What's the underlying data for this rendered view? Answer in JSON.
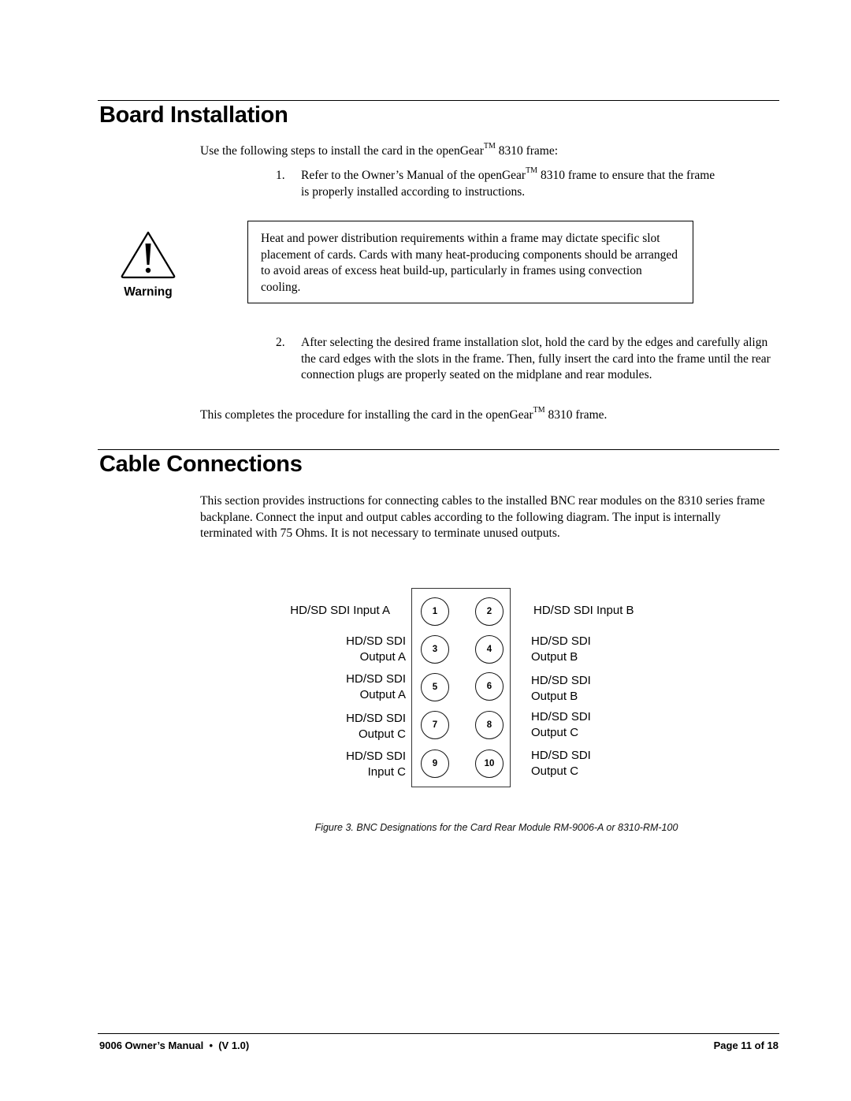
{
  "board_installation": {
    "heading": "Board Installation",
    "intro_prefix": "Use the following steps to install the card in the openGear",
    "tm": "TM",
    "intro_suffix": " 8310 frame:",
    "steps": [
      {
        "number": "1.",
        "line1_prefix": "Refer to the Owner’s Manual of the openGear",
        "line1_suffix": " 8310 frame to ensure that the frame",
        "line2": "is properly installed according to instructions."
      },
      {
        "number": "2.",
        "text": "After selecting the desired frame installation slot, hold the card by the edges and carefully align the card edges with the slots in the frame.  Then, fully insert the card into the frame until the rear connection plugs are properly seated on the midplane and rear modules."
      }
    ],
    "warning": {
      "icon": "warning-triangle-icon",
      "label": "Warning",
      "text": "Heat and power distribution requirements within a frame may dictate specific slot placement of cards.  Cards with many heat-producing components should be arranged to avoid areas of excess heat build-up, particularly in frames using convection cooling."
    },
    "conclusion_prefix": "This completes the procedure for installing the card in the openGear",
    "conclusion_suffix": " 8310 frame."
  },
  "cable_connections": {
    "heading": "Cable Connections",
    "body": "This section provides instructions for connecting cables to the installed BNC rear modules on the 8310 series frame backplane. Connect the input and output cables according to the following diagram. The input is internally terminated with 75 Ohms.  It is not necessary to terminate unused outputs.",
    "diagram": {
      "connectors": [
        {
          "number": "1",
          "label_lines": [
            "HD/SD SDI Input A"
          ]
        },
        {
          "number": "2",
          "label_lines": [
            "HD/SD SDI Input B"
          ]
        },
        {
          "number": "3",
          "label_lines": [
            "HD/SD SDI",
            "Output A"
          ]
        },
        {
          "number": "4",
          "label_lines": [
            "HD/SD SDI",
            "Output B"
          ]
        },
        {
          "number": "5",
          "label_lines": [
            "HD/SD SDI",
            "Output A"
          ]
        },
        {
          "number": "6",
          "label_lines": [
            "HD/SD SDI",
            "Output B"
          ]
        },
        {
          "number": "7",
          "label_lines": [
            "HD/SD SDI",
            "Output C"
          ]
        },
        {
          "number": "8",
          "label_lines": [
            "HD/SD SDI",
            "Output C"
          ]
        },
        {
          "number": "9",
          "label_lines": [
            "HD/SD SDI",
            "Input C"
          ]
        },
        {
          "number": "10",
          "label_lines": [
            "HD/SD SDI",
            "Output C"
          ]
        }
      ]
    },
    "caption": "Figure 3. BNC Designations for the Card Rear Module RM-9006-A or 8310-RM-100"
  },
  "footer": {
    "left": "9006 Owner’s Manual  •  (V 1.0)",
    "right": "Page 11 of 18"
  }
}
